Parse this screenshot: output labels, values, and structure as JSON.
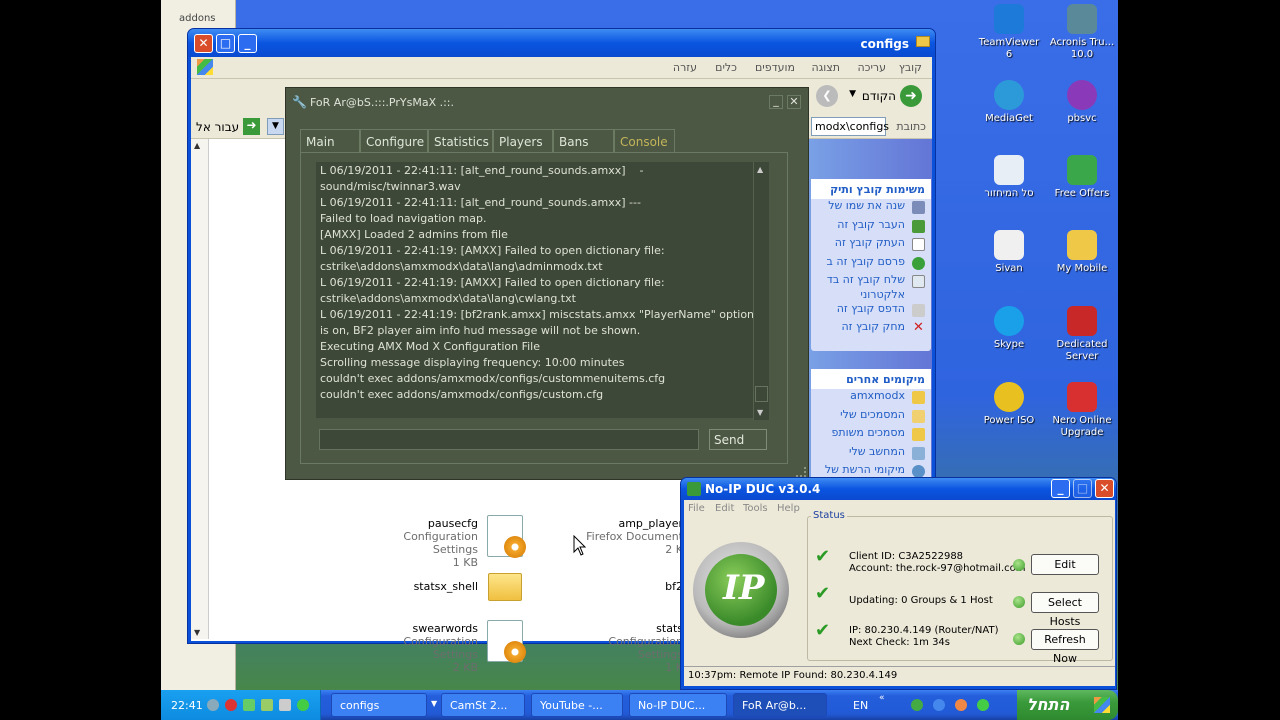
{
  "background_window": {
    "label": "addons"
  },
  "explorer": {
    "title": "configs",
    "menu": [
      "קובץ",
      "עריכה",
      "תצוגה",
      "מועדפים",
      "כלים",
      "עזרה"
    ],
    "toolbar": {
      "back_label": "הקודם"
    },
    "address": {
      "label": "כתובת",
      "value": "modx\\configs",
      "go_label": "עבור אל"
    },
    "file_tasks": {
      "heading": "משימות קובץ ותיק",
      "items": [
        "שנה את שמו של",
        "העבר קובץ זה",
        "העתק קובץ זה",
        "פרסם קובץ זה ב",
        "שלח קובץ זה בד",
        "אלקטרוני",
        "הדפס קובץ זה",
        "מחק קובץ זה"
      ]
    },
    "other_places": {
      "heading": "מיקומים אחרים",
      "items": [
        "amxmodx",
        "המסמכים שלי",
        "מסמכים משותפ",
        "המחשב שלי",
        "מיקומי הרשת של"
      ]
    },
    "files": [
      {
        "name": "pausecfg",
        "type": "Configuration Settings",
        "size": "1 KB"
      },
      {
        "name": "statsx_shell",
        "type": "",
        "size": ""
      },
      {
        "name": "swearwords",
        "type": "Configuration Settings",
        "size": "2 KB"
      },
      {
        "name": "amp_player",
        "type": "Firefox Document",
        "size": "2 K"
      },
      {
        "name": "bf2",
        "type": "",
        "size": ""
      },
      {
        "name": "stats",
        "type": "Configuration Settings",
        "size": "1 K"
      }
    ]
  },
  "console": {
    "title": "FoR Ar@bS.:::.PrYsMaX .::.",
    "tabs": [
      "Main",
      "Configure",
      "Statistics",
      "Players",
      "Bans",
      "Console"
    ],
    "active_tab": "Console",
    "log": "L 06/19/2011 - 22:41:11: [alt_end_round_sounds.amxx]    -\nsound/misc/twinnar3.wav\nL 06/19/2011 - 22:41:11: [alt_end_round_sounds.amxx] ---\nFailed to load navigation map.\n[AMXX] Loaded 2 admins from file\nL 06/19/2011 - 22:41:19: [AMXX] Failed to open dictionary file:\ncstrike\\addons\\amxmodx\\data\\lang\\adminmodx.txt\nL 06/19/2011 - 22:41:19: [AMXX] Failed to open dictionary file:\ncstrike\\addons\\amxmodx\\data\\lang\\cwlang.txt\nL 06/19/2011 - 22:41:19: [bf2rank.amxx] miscstats.amxx \"PlayerName\" option\nis on, BF2 player aim info hud message will not be shown.\nExecuting AMX Mod X Configuration File\nScrolling message displaying frequency: 10:00 minutes\ncouldn't exec addons/amxmodx/configs/custommenuitems.cfg\ncouldn't exec addons/amxmodx/configs/custom.cfg",
    "input_value": "",
    "send_label": "Send"
  },
  "desktop_icons": [
    {
      "label": "TeamViewer 6",
      "color": "#1e7ad8"
    },
    {
      "label": "Acronis Tru... 10.0",
      "color": "#5a8a9a"
    },
    {
      "label": "MediaGet",
      "color": "#2c9ad8"
    },
    {
      "label": "pbsvc",
      "color": "#8a3ab8"
    },
    {
      "label": "סל המיחזור",
      "color": "#e8eef6"
    },
    {
      "label": "Free Offers",
      "color": "#3aa84a"
    },
    {
      "label": "Sivan",
      "color": "#f0f0f0"
    },
    {
      "label": "My Mobile",
      "color": "#f0c848"
    },
    {
      "label": "Skype",
      "color": "#1aa0e8"
    },
    {
      "label": "Dedicated Server",
      "color": "#c82828"
    },
    {
      "label": "Power ISO",
      "color": "#e8c020"
    },
    {
      "label": "Nero Online Upgrade",
      "color": "#d83030"
    }
  ],
  "noip": {
    "title": "No-IP DUC v3.0.4",
    "menu": [
      "File",
      "Edit",
      "Tools",
      "Help"
    ],
    "status_label": "Status",
    "rows": [
      {
        "line1": "Client ID: C3A2522988",
        "line2": "Account: the.rock-97@hotmail.com",
        "button": "Edit"
      },
      {
        "line1": "Updating: 0 Groups & 1 Host",
        "line2": "",
        "button": "Select Hosts"
      },
      {
        "line1": "IP: 80.230.4.149 (Router/NAT)",
        "line2": "Next Check: 1m 34s",
        "button": "Refresh Now"
      }
    ],
    "statusbar": "10:37pm: Remote IP Found: 80.230.4.149"
  },
  "taskbar": {
    "clock": "22:41",
    "start_label": "התחל",
    "language": "EN",
    "buttons": [
      "configs",
      "CamSt 2...",
      "YouTube -...",
      "No-IP DUC...",
      "FoR Ar@b..."
    ]
  }
}
